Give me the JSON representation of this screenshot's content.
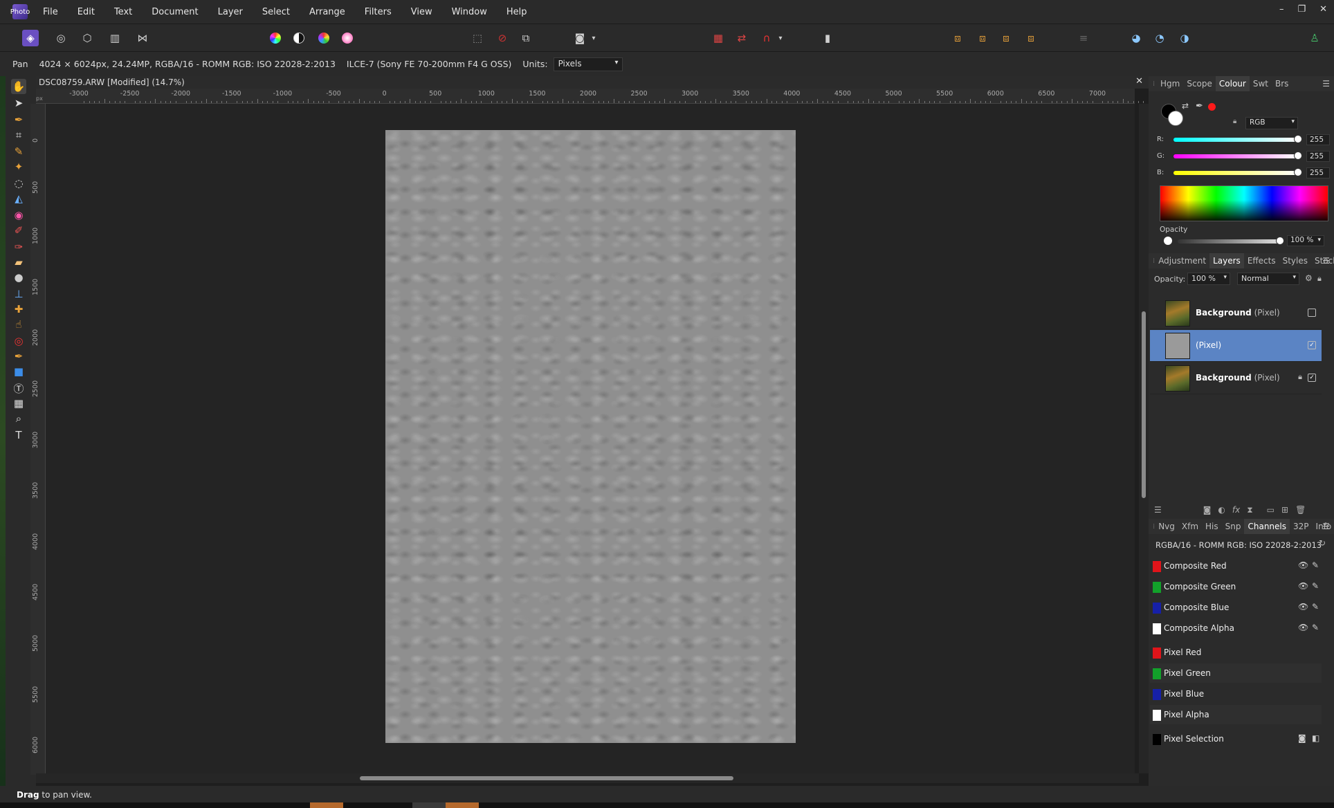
{
  "menubar": {
    "app_logo": "Photo",
    "items": [
      "File",
      "Edit",
      "Text",
      "Document",
      "Layer",
      "Select",
      "Arrange",
      "Filters",
      "View",
      "Window",
      "Help"
    ],
    "win_controls": [
      "–",
      "❐",
      "✕"
    ]
  },
  "toolbar": {
    "personas": [
      "photo-persona",
      "liquify-persona",
      "develop-persona",
      "tone-mapping-persona",
      "export-persona"
    ],
    "adjust_icons": [
      "color-wheel-icon",
      "contrast-icon",
      "saturation-icon",
      "white-balance-icon"
    ],
    "selection_icons": [
      "marquee-icon",
      "deselect-icon",
      "invert-selection-icon"
    ],
    "mask_icon": "quick-mask-icon",
    "snapping_icons": [
      "grid-icon",
      "assistant-icon",
      "snap-magnet-icon"
    ],
    "misc_icon": "paint-mixer-icon",
    "arrange_icons": [
      "move-to-back-icon",
      "move-back-icon",
      "move-forward-icon",
      "move-to-front-icon"
    ],
    "align_icon": "align-icon",
    "boolean_icons": [
      "add-icon",
      "subtract-icon",
      "intersect-icon"
    ],
    "account_icon": "user-icon"
  },
  "context": {
    "tool": "Pan",
    "doc_info": "4024 × 6024px, 24.24MP, RGBA/16 - ROMM RGB: ISO 22028-2:2013",
    "camera": "ILCE-7 (Sony FE 70-200mm F4 G OSS)",
    "units_label": "Units:",
    "units_value": "Pixels"
  },
  "document": {
    "title": "DSC08759.ARW [Modified] (14.7%)",
    "close": "✕",
    "ruler_unit": "px",
    "h_ticks": [
      "-3000",
      "-2500",
      "-2000",
      "-1500",
      "-1000",
      "-500",
      "0",
      "500",
      "1000",
      "1500",
      "2000",
      "2500",
      "3000",
      "3500",
      "4000",
      "4500",
      "5000",
      "5500",
      "6000",
      "6500",
      "7000"
    ],
    "v_ticks": [
      "0",
      "500",
      "1000",
      "1500",
      "2000",
      "2500",
      "3000",
      "3500",
      "4000",
      "4500",
      "5000",
      "5500",
      "6000"
    ]
  },
  "tools": [
    "hand-icon",
    "move-icon",
    "color-picker-icon",
    "crop-icon",
    "selection-brush-icon",
    "flood-select-icon",
    "marquee-icon",
    "fill-icon",
    "gradient-icon",
    "paint-brush-icon",
    "color-replace-icon",
    "erase-icon",
    "dodge-icon",
    "clone-icon",
    "healing-icon",
    "smudge-icon",
    "red-eye-icon",
    "pen-icon",
    "shape-icon",
    "frame-text-icon",
    "mesh-warp-icon",
    "zoom-icon",
    "artistic-text-icon"
  ],
  "colour_panel": {
    "tabs": [
      "Hgm",
      "Scope",
      "Colour",
      "Swt",
      "Brs"
    ],
    "active_tab": "Colour",
    "model": "RGB",
    "r": {
      "label": "R:",
      "value": "255"
    },
    "g": {
      "label": "G:",
      "value": "255"
    },
    "b": {
      "label": "B:",
      "value": "255"
    },
    "opacity_label": "Opacity",
    "opacity_value": "100 %",
    "colors": {
      "primary": "#000000",
      "secondary": "#ffffff",
      "accent": "#ff1a1a"
    }
  },
  "layers_panel": {
    "tabs": [
      "Adjustment",
      "Layers",
      "Effects",
      "Styles",
      "Stock"
    ],
    "active_tab": "Layers",
    "opacity_label": "Opacity:",
    "opacity_value": "100 %",
    "blend_mode": "Normal",
    "layers": [
      {
        "name": "Background",
        "kind": "(Pixel)",
        "checked": "",
        "selected": false,
        "locked": false
      },
      {
        "name": "",
        "kind": "(Pixel)",
        "checked": "✓",
        "selected": true,
        "locked": false
      },
      {
        "name": "Background",
        "kind": "(Pixel)",
        "checked": "✓",
        "selected": false,
        "locked": true
      }
    ]
  },
  "channels_panel": {
    "tabs": [
      "Nvg",
      "Xfm",
      "His",
      "Snp",
      "Channels",
      "32P",
      "Info"
    ],
    "active_tab": "Channels",
    "format": "RGBA/16 - ROMM RGB: ISO 22028-2:2013",
    "composite": [
      {
        "name": "Composite Red",
        "color": "#e0141a"
      },
      {
        "name": "Composite Green",
        "color": "#12a12a"
      },
      {
        "name": "Composite Blue",
        "color": "#1620a8"
      },
      {
        "name": "Composite Alpha",
        "color": "#ffffff"
      }
    ],
    "pixel": [
      {
        "name": "Pixel Red",
        "color": "#e0141a"
      },
      {
        "name": "Pixel Green",
        "color": "#12a12a"
      },
      {
        "name": "Pixel Blue",
        "color": "#1620a8"
      },
      {
        "name": "Pixel Alpha",
        "color": "#ffffff"
      }
    ],
    "selection": {
      "name": "Pixel Selection",
      "color": "#000000"
    }
  },
  "status": {
    "bold": "Drag",
    "text": " to pan view."
  }
}
